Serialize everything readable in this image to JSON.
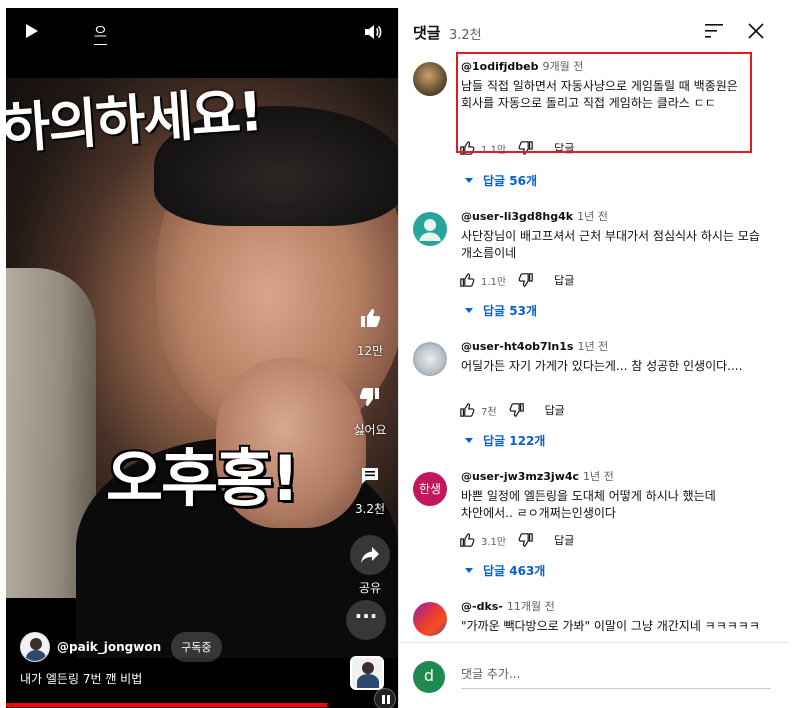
{
  "video": {
    "caption_toggle": "으",
    "overlay_top": "하의하세요!",
    "overlay_big": "오후홍!",
    "rail": {
      "like_count": "12만",
      "dislike_label": "싫어요",
      "comment_count": "3.2천",
      "share_label": "공유"
    },
    "channel_name": "@paik_jongwon",
    "subscribe_label": "구독중",
    "title": "내가 엘든링 7번 깬 비법",
    "progress": 0.82
  },
  "comments_panel": {
    "title": "댓글",
    "count": "3.2천",
    "reply_label": "답글",
    "comments": [
      {
        "user": "@1odifjdbeb",
        "time": "9개월 전",
        "text": "남들 직접 일하면서 자동사냥으로 게임돌릴 때 백종원은 회사를 자동으로 돌리고 직접 게임하는 클라스 ㄷㄷ",
        "likes": "1.1만",
        "replies": "답글 56개",
        "avatar": "photo"
      },
      {
        "user": "@user-li3gd8hg4k",
        "time": "1년 전",
        "text": "사단장님이 배고프셔서 근처 부대가서 점심식사 하시는 모습 개소름이네",
        "likes": "1.1만",
        "replies": "답글 53개",
        "avatar": "default-teal"
      },
      {
        "user": "@user-ht4ob7ln1s",
        "time": "1년 전",
        "text": "어딜가든 자기 가게가 있다는게... 참 성공한 인생이다....",
        "likes": "7천",
        "replies": "답글 122개",
        "avatar": "photo-light"
      },
      {
        "user": "@user-jw3mz3jw4c",
        "time": "1년 전",
        "text": "바쁜 일정에 엘든링을 도대체 어떻게 하시나 했는데 차안에서.. ㄹㅇ개쩌는인생이다",
        "likes": "3.1만",
        "replies": "답글 463개",
        "avatar": "text",
        "avatar_text": "한생",
        "avatar_color": "#c2185b"
      },
      {
        "user": "@-dks-",
        "time": "11개월 전",
        "text": "\"가까운 빽다방으로 가봐\" 이말이 그냥 개간지네 ㅋㅋㅋㅋㅋ",
        "avatar": "gradient"
      }
    ],
    "add_comment_placeholder": "댓글 추가...",
    "me_initial": "d"
  },
  "colors": {
    "accent_blue": "#065fd4",
    "highlight_red": "#e21b23",
    "progress_red": "#ff0000"
  }
}
